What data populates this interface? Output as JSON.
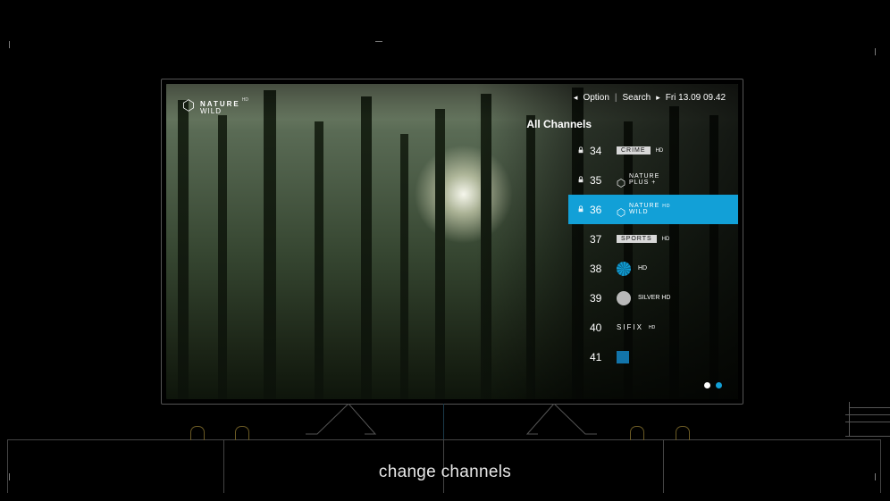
{
  "current_channel_logo": {
    "line1": "NATURE",
    "line2": "WILD",
    "badge": "HD"
  },
  "top_nav": {
    "option": "Option",
    "search": "Search",
    "datetime": "Fri 13.09 09.42"
  },
  "panel_title": "All Channels",
  "selected_number": "36",
  "channels": [
    {
      "locked": true,
      "number": "34",
      "brand": {
        "type": "box",
        "label": "CRIME",
        "badge": "HD"
      }
    },
    {
      "locked": true,
      "number": "35",
      "brand": {
        "type": "hex",
        "line1": "NATURE",
        "line2": "PLUS +"
      }
    },
    {
      "locked": true,
      "number": "36",
      "brand": {
        "type": "hex",
        "line1": "NATURE",
        "line2": "WILD",
        "badge": "HD"
      }
    },
    {
      "locked": false,
      "number": "37",
      "brand": {
        "type": "box",
        "label": "SPORTS",
        "badge": "HD"
      }
    },
    {
      "locked": false,
      "number": "38",
      "brand": {
        "type": "circle",
        "label": "HD",
        "color": "#12a0d7",
        "striped": true
      }
    },
    {
      "locked": false,
      "number": "39",
      "brand": {
        "type": "circle",
        "label": "SILVER HD",
        "color": "#b8b8b8"
      }
    },
    {
      "locked": false,
      "number": "40",
      "brand": {
        "type": "text",
        "label": "SIFIX",
        "badge": "HD"
      }
    },
    {
      "locked": false,
      "number": "41",
      "brand": {
        "type": "square",
        "color": "#1274aa"
      }
    }
  ],
  "page_dots": {
    "count": 2,
    "active": 2
  },
  "caption": "change channels"
}
